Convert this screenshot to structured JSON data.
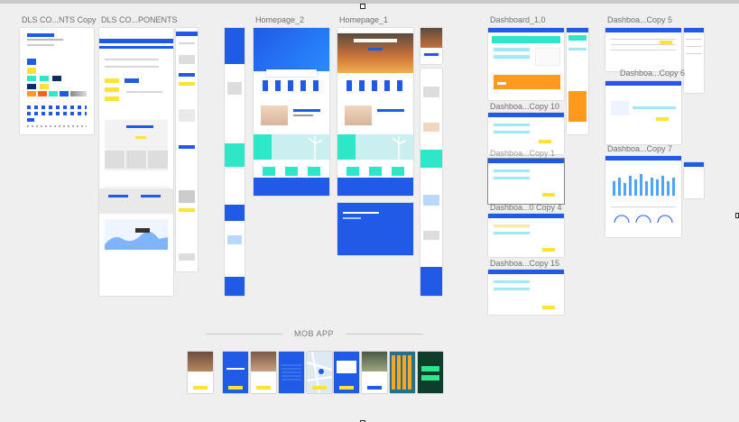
{
  "artboards": {
    "dls_components_copy": "DLS CO...NTS Copy",
    "dls_components": "DLS CO...PONENTS",
    "homepage_2": "Homepage_2",
    "homepage_1": "Homepage_1",
    "dashboard_1": "Dashboard_1.0",
    "dashboard_copy_5": "Dashboa...Copy 5",
    "dashboard_copy_6": "Dashboa...Copy 6",
    "dashboard_copy_10": "Dashboa...Copy 10",
    "dashboard_copy_7": "Dashboa...Copy 7",
    "dashboard_copy_4": "Dashboa...0 Copy 4",
    "dashboard_copy_15": "Dashboa...Copy 15",
    "dashboard_overlap": "Dashboa...Copy 1"
  },
  "hero_text": {
    "dls_headline": "Headline Titles",
    "homepage_hero": "The DLS Energy App lets you stay in control",
    "homepage_cta": "Get started"
  },
  "section": {
    "mob_app": "MOB APP"
  },
  "colors": {
    "brand_blue": "#1f5be6",
    "accent_yellow": "#ffe236",
    "accent_teal": "#2ee6c8",
    "accent_orange": "#ff9a1f",
    "navy": "#0b2a6b"
  }
}
